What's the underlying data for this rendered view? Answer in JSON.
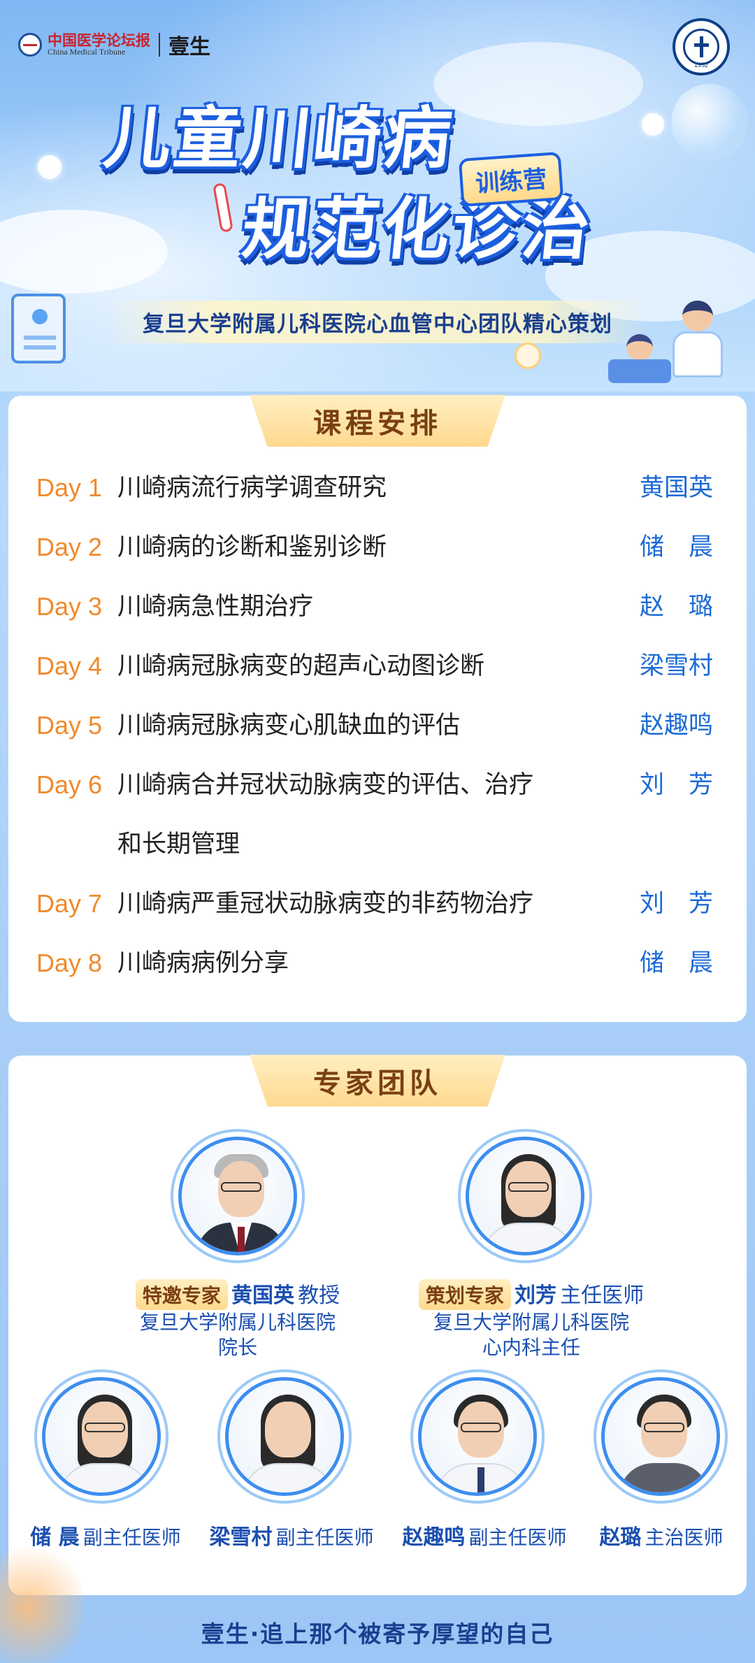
{
  "header": {
    "brand_cn": "中国医学论坛报",
    "brand_en": "China Medical Tribune",
    "brand_yi": "壹生",
    "seal_year": "1952",
    "title_line1": "儿童川崎病",
    "title_line2": "规范化诊治",
    "camp_tag": "训练营",
    "subtitle": "复旦大学附属儿科医院心血管中心团队精心策划"
  },
  "schedule": {
    "heading": "课程安排",
    "rows": [
      {
        "day": "Day 1",
        "topic": "川崎病流行病学调查研究",
        "speaker": "黄国英"
      },
      {
        "day": "Day 2",
        "topic": "川崎病的诊断和鉴别诊断",
        "speaker": "储　晨"
      },
      {
        "day": "Day 3",
        "topic": "川崎病急性期治疗",
        "speaker": "赵　璐"
      },
      {
        "day": "Day 4",
        "topic": "川崎病冠脉病变的超声心动图诊断",
        "speaker": "梁雪村"
      },
      {
        "day": "Day 5",
        "topic": "川崎病冠脉病变心肌缺血的评估",
        "speaker": "赵趣鸣"
      },
      {
        "day": "Day 6",
        "topic": "川崎病合并冠状动脉病变的评估、治疗",
        "topic_cont": "和长期管理",
        "speaker": "刘　芳"
      },
      {
        "day": "Day 7",
        "topic": "川崎病严重冠状动脉病变的非药物治疗",
        "speaker": "刘　芳"
      },
      {
        "day": "Day 8",
        "topic": "川崎病病例分享",
        "speaker": "储　晨"
      }
    ]
  },
  "experts": {
    "heading": "专家团队",
    "featured": [
      {
        "tag": "特邀专家",
        "name": "黄国英",
        "title": "教授",
        "org": "复旦大学附属儿科医院",
        "role": "院长"
      },
      {
        "tag": "策划专家",
        "name": "刘芳",
        "title": "主任医师",
        "org": "复旦大学附属儿科医院",
        "role": "心内科主任"
      }
    ],
    "members": [
      {
        "name": "储 晨",
        "title": "副主任医师"
      },
      {
        "name": "梁雪村",
        "title": "副主任医师"
      },
      {
        "name": "赵趣鸣",
        "title": "副主任医师"
      },
      {
        "name": "赵璐",
        "title": "主治医师"
      }
    ]
  },
  "footer": {
    "slogan": "壹生·追上那个被寄予厚望的自己"
  },
  "colors": {
    "accent_orange": "#f08a2b",
    "speaker_blue": "#1b6ad6",
    "heading_brown": "#7a3f12",
    "tag_gold": "#ffd98f"
  }
}
